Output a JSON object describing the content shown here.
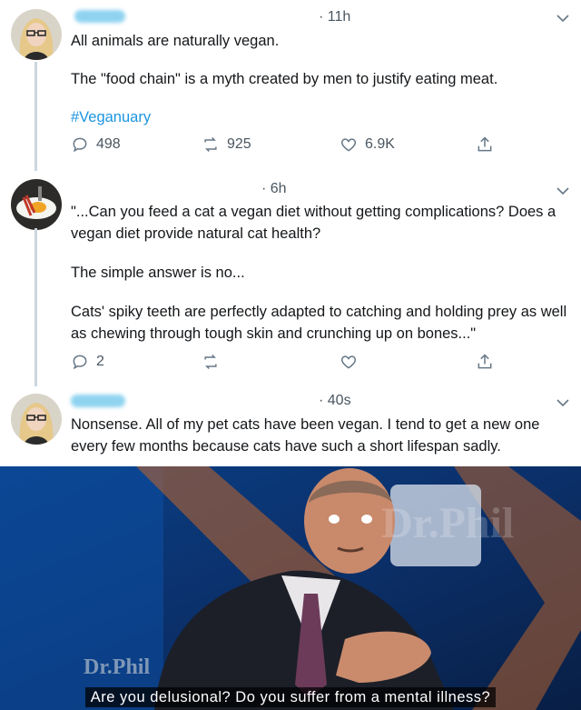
{
  "tweets": [
    {
      "time": "· 11h",
      "lines": [
        "All animals are naturally vegan.",
        "The \"food chain\" is a myth created by men to justify eating meat."
      ],
      "hashtag": "#Veganuary",
      "reply_count": "498",
      "retweet_count": "925",
      "like_count": "6.9K"
    },
    {
      "time": "· 6h",
      "paragraphs": [
        "\"...Can you feed a cat a vegan diet without getting complications? Does a vegan diet provide natural cat health?",
        "The simple answer is no...",
        "Cats' spiky teeth are perfectly adapted to catching and holding prey as well as chewing through tough skin and crunching up on bones...\""
      ],
      "reply_count": "2"
    },
    {
      "time": "· 40s",
      "text": "Nonsense. All of my pet cats have been vegan. I tend to get a new one every few months because cats have such a short lifespan sadly."
    }
  ],
  "meme": {
    "logo_text": "Dr.Phil",
    "corner_logo": "Dr.Phil",
    "caption": "Are you delusional? Do you suffer from a mental illness?"
  },
  "colors": {
    "hashtag": "#1b95e0",
    "username_blur": "#8fd3f0",
    "thread_line": "#ccd6dd",
    "meme_background": "#0b2a5a"
  },
  "icons": [
    "reply-icon",
    "retweet-icon",
    "like-icon",
    "share-icon",
    "caret-down-icon"
  ]
}
